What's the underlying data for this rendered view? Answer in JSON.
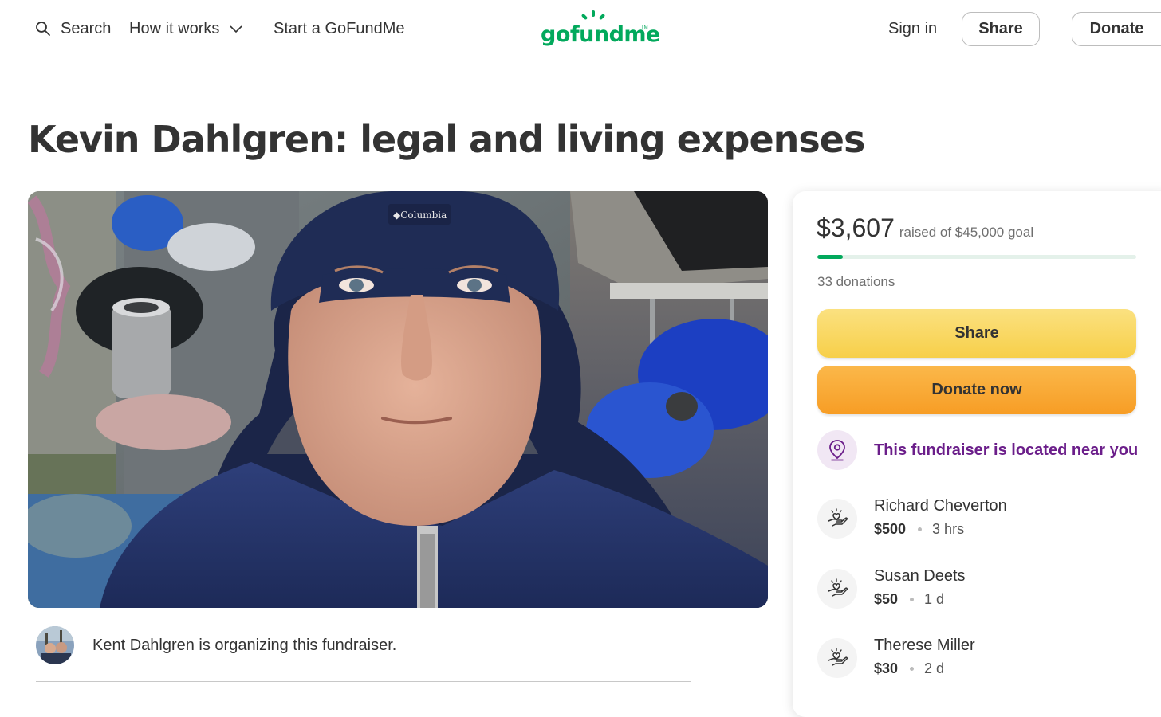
{
  "nav": {
    "search_label": "Search",
    "how_label": "How it works",
    "start_label": "Start a GoFundMe",
    "logo_text": "gofundme",
    "logo_tm": "TM",
    "signin_label": "Sign in",
    "share_label": "Share",
    "donate_label": "Donate"
  },
  "campaign": {
    "title": "Kevin Dahlgren: legal and living expenses",
    "organizer_text": "Kent Dahlgren is organizing this fundraiser."
  },
  "sidebar": {
    "raised_amount": "$3,607",
    "raised_goal": "raised of $45,000 goal",
    "progress_percent": 8,
    "donation_count": "33 donations",
    "share_label": "Share",
    "donate_label": "Donate now",
    "near_text": "This fundraiser is located near you",
    "donors": [
      {
        "name": "Richard Cheverton",
        "amount": "$500",
        "time": "3 hrs"
      },
      {
        "name": "Susan Deets",
        "amount": "$50",
        "time": "1 d"
      },
      {
        "name": "Therese Miller",
        "amount": "$30",
        "time": "2 d"
      }
    ]
  },
  "colors": {
    "brand": "#02a95c",
    "near_purple": "#6b1e8a",
    "share_yellow": "#f7cf49",
    "donate_orange": "#f79d25"
  },
  "icons": {
    "search": "search-icon",
    "how_dropdown": "chevron-down-icon",
    "near": "location-pin-icon",
    "donor": "heart-hand-icon"
  }
}
